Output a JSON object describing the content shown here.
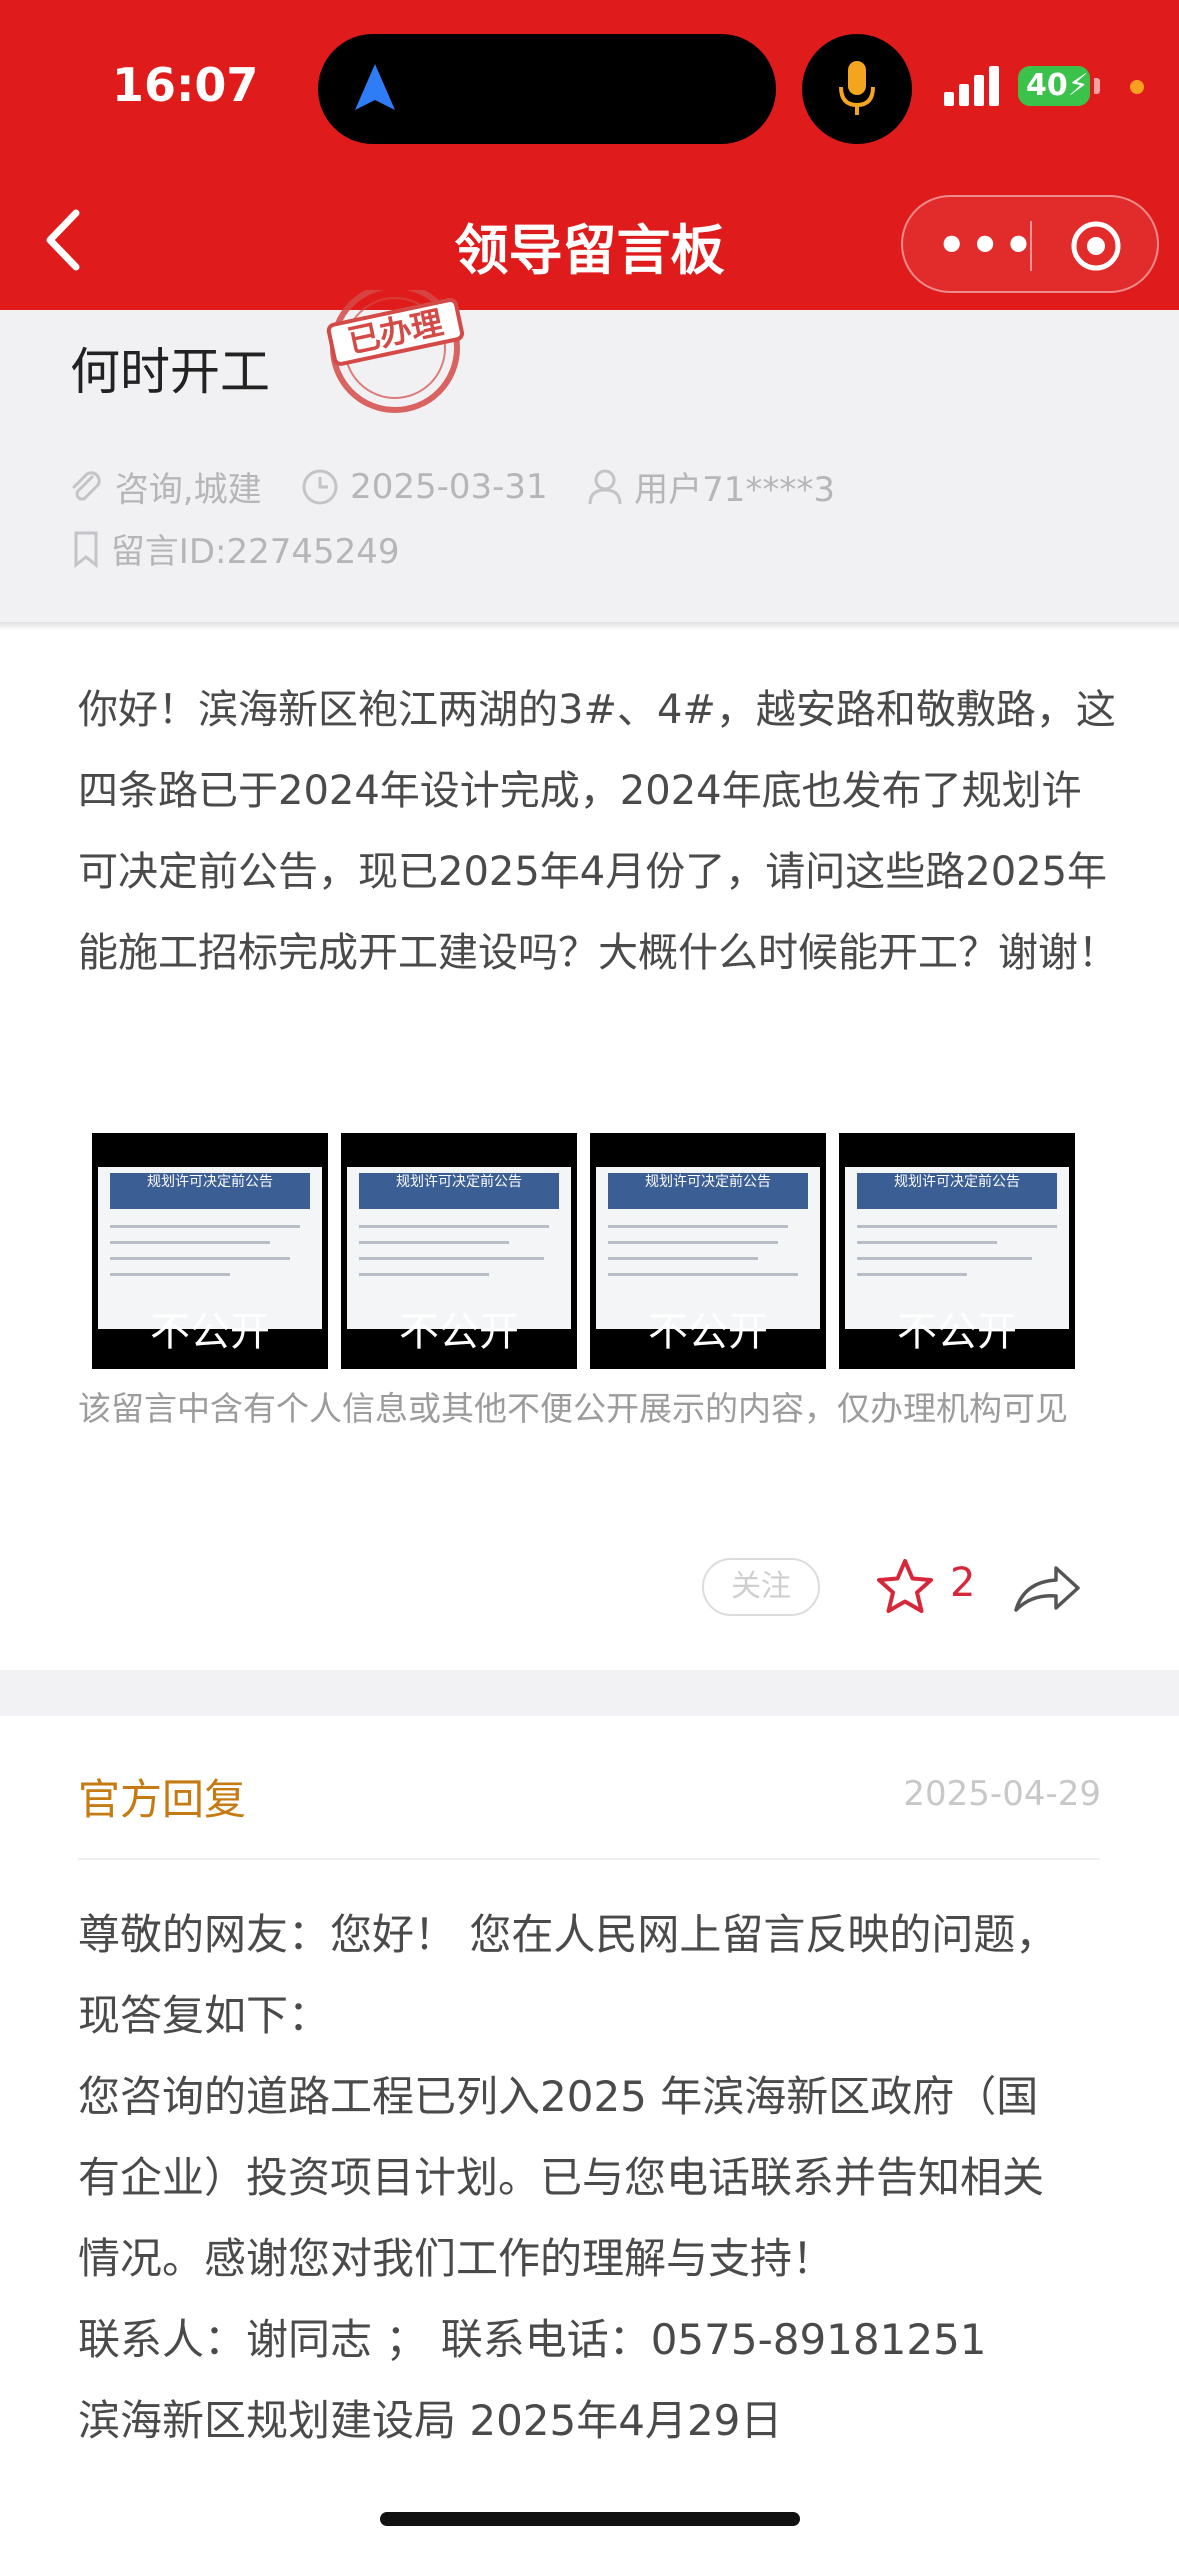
{
  "status": {
    "time": "16:07",
    "battery": "40"
  },
  "nav": {
    "title": "领导留言板",
    "more": "•••"
  },
  "message": {
    "title": "何时开工",
    "stamp_text": "已办理",
    "category": "咨询,城建",
    "date": "2025-03-31",
    "user": "用户71****3",
    "id": "留言ID:22745249",
    "body": "你好！滨海新区袍江两湖的3#、4#，越安路和敬敷路，这四条路已于2024年设计完成，2024年底也发布了规划许可决定前公告，现已2025年4月份了，请问这些路2025年能施工招标完成开工建设吗？大概什么时候能开工？谢谢！",
    "attachments": [
      {
        "label": "不公开",
        "header": "规划许可决定前公告"
      },
      {
        "label": "不公开",
        "header": "规划许可决定前公告"
      },
      {
        "label": "不公开",
        "header": "规划许可决定前公告"
      },
      {
        "label": "不公开",
        "header": "规划许可决定前公告"
      }
    ],
    "privacy_notice": "该留言中含有个人信息或其他不便公开展示的内容，仅办理机构可见",
    "follow_label": "关注",
    "like_count": "2"
  },
  "reply": {
    "heading": "官方回复",
    "date": "2025-04-29",
    "lines": [
      "尊敬的网友：您好！ 您在人民网上留言反映的问题，",
      "现答复如下：",
      "您咨询的道路工程已列入2025 年滨海新区政府（国",
      "有企业）投资项目计划。已与您电话联系并告知相关",
      "情况。感谢您对我们工作的理解与支持！",
      "联系人：谢同志 ； 联系电话：0575-89181251",
      "滨海新区规划建设局 2025年4月29日"
    ]
  },
  "colors": {
    "brand_red": "#e01b1b",
    "reply_heading": "#c57a12",
    "like_red": "#d6283a"
  }
}
